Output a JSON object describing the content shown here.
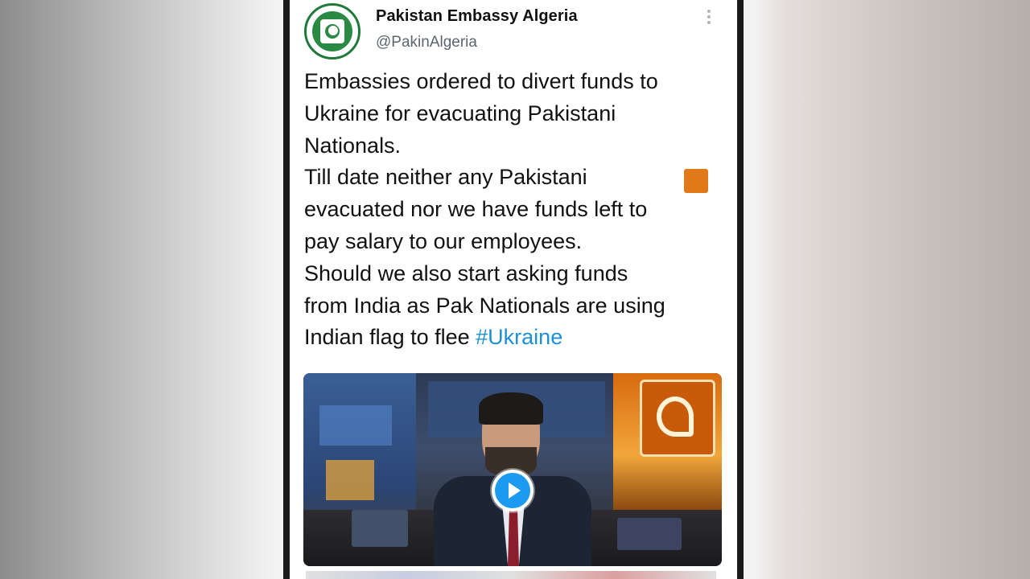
{
  "account": {
    "display_name": "Pakistan Embassy Algeria",
    "handle": "@PakinAlgeria"
  },
  "tweet": {
    "lines": [
      "Embassies ordered to divert funds to",
      "Ukraine for evacuating Pakistani",
      "Nationals.",
      "Till date neither any Pakistani",
      "evacuated nor we have funds left to",
      "pay salary to our employees.",
      "Should we also start asking funds",
      "from India as Pak Nationals are using",
      "Indian flag to flee "
    ],
    "hashtag": "#Ukraine"
  },
  "colors": {
    "hashtag": "#1d8fd6",
    "play_button": "#1d9bf0",
    "avatar_ring": "#1f7a3a"
  },
  "icons": {
    "avatar": "embassy-crest-icon",
    "more": "more-vertical-icon",
    "play": "play-icon"
  }
}
